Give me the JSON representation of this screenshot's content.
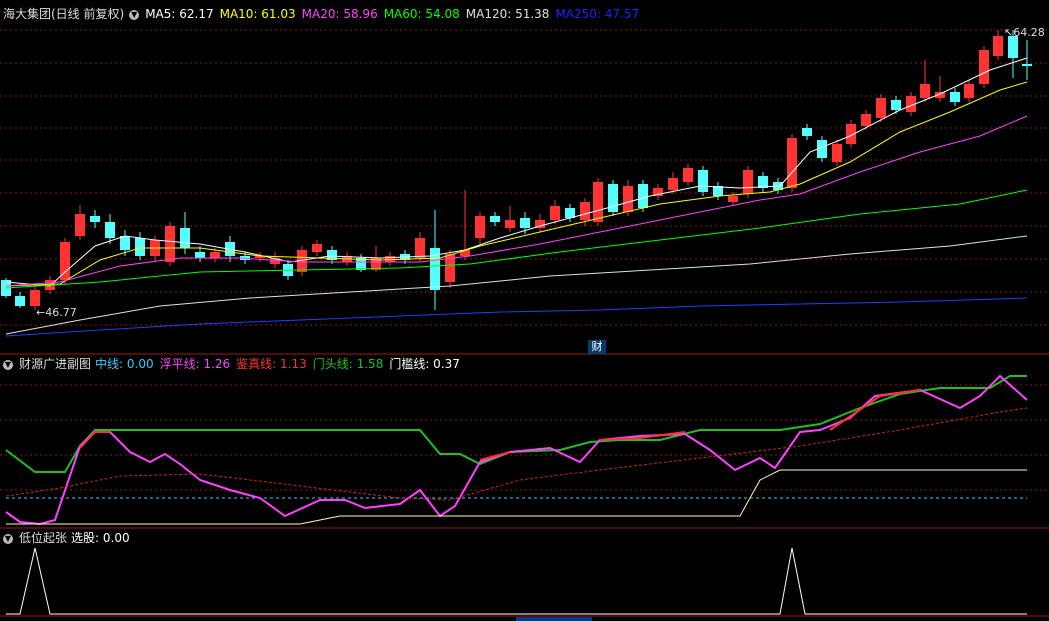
{
  "main_panel": {
    "title": "海大集团(日线 前复权)",
    "ma_labels": [
      {
        "label": "MA5: 62.17",
        "color": "#ffffff"
      },
      {
        "label": "MA10: 61.03",
        "color": "#ffff00"
      },
      {
        "label": "MA20: 58.96",
        "color": "#ff40ff"
      },
      {
        "label": "MA60: 54.08",
        "color": "#00ff00"
      },
      {
        "label": "MA120: 51.38",
        "color": "#e0e0e0"
      },
      {
        "label": "MA250: 47.57",
        "color": "#2020ff"
      }
    ],
    "high_marker": "64.28",
    "low_marker": "46.77",
    "finance_badge": "财"
  },
  "indicator_panel": {
    "title": "财源广进副图",
    "labels": [
      {
        "label": "中线: 0.00",
        "color": "#33ccff"
      },
      {
        "label": "浮平线: 1.26",
        "color": "#ff40ff"
      },
      {
        "label": "鉴真线: 1.13",
        "color": "#ff3030"
      },
      {
        "label": "门头线: 1.58",
        "color": "#20c020"
      },
      {
        "label": "门槛线: 0.37",
        "color": "#ffffff"
      }
    ]
  },
  "signal_panel": {
    "title": "低位起张",
    "labels": [
      {
        "label": "选股: 0.00",
        "color": "#ffffff"
      }
    ]
  },
  "colors": {
    "up": "#ff3333",
    "down": "#55ffff",
    "grid": "#8b1a1a",
    "border": "#a01818"
  },
  "icons": {
    "collapse": "chevron-down-icon"
  }
}
